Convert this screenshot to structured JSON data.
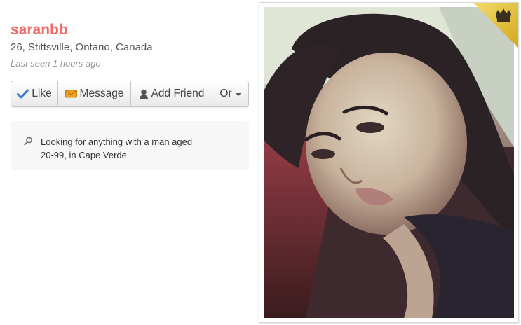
{
  "profile": {
    "username": "saranbb",
    "location": "26, Stittsville, Ontario, Canada",
    "last_seen": "Last seen 1 hours ago"
  },
  "actions": {
    "like_label": "Like",
    "message_label": "Message",
    "add_friend_label": "Add Friend",
    "or_label": "Or"
  },
  "looking_for": {
    "text": "Looking for anything with a man aged 20-99, in Cape Verde."
  },
  "icons": {
    "like": "check-icon",
    "message": "envelope-icon",
    "add_friend": "person-icon",
    "or": "chevron-down-icon",
    "looking": "search-icon",
    "badge": "crown-icon"
  },
  "colors": {
    "username": "#f06a6a",
    "like_check": "#3a7bd5",
    "message_envelope": "#f0a21e",
    "badge": "#e8c23a"
  }
}
